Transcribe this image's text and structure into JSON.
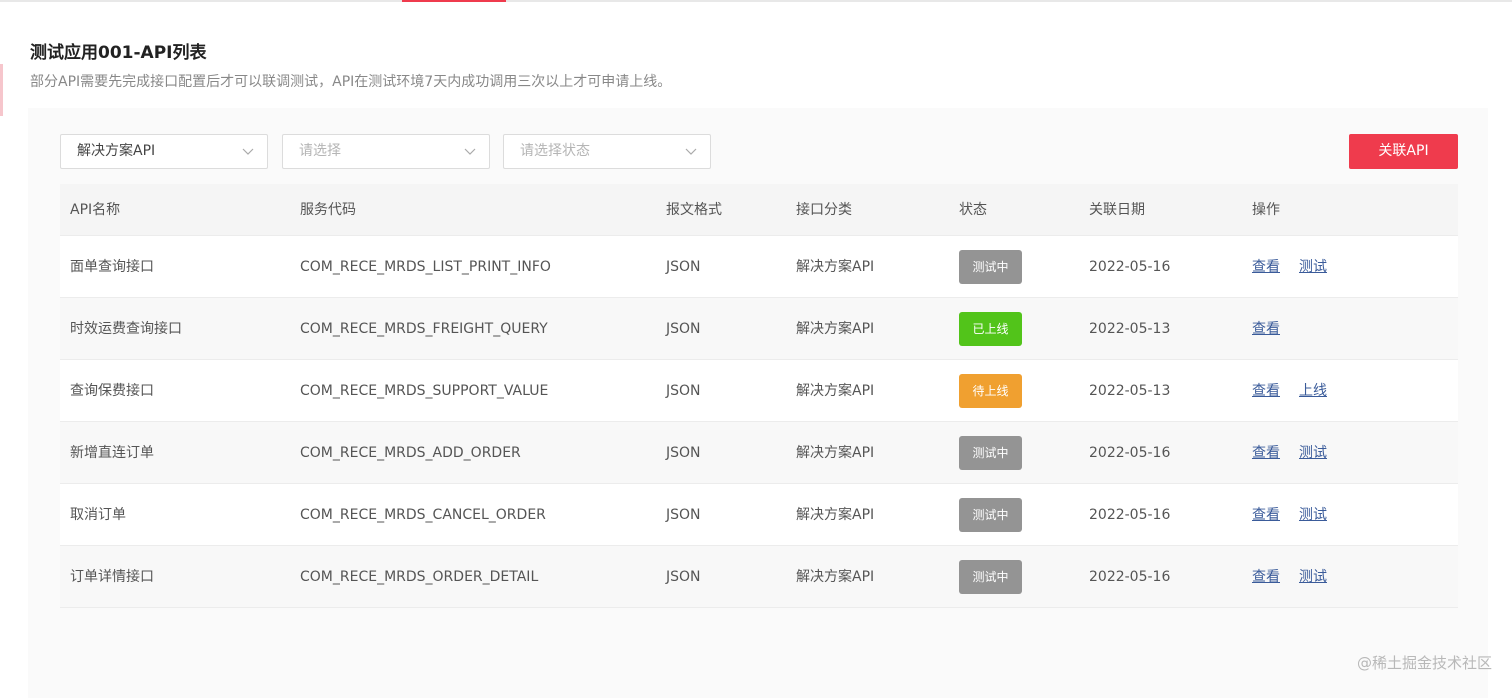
{
  "header": {
    "title": "测试应用001-API列表",
    "description": "部分API需要先完成接口配置后才可以联调测试，API在测试环境7天内成功调用三次以上才可申请上线。"
  },
  "filters": {
    "category": {
      "value": "解决方案API"
    },
    "select2": {
      "placeholder": "请选择"
    },
    "status": {
      "placeholder": "请选择状态"
    }
  },
  "toolbar": {
    "associate_label": "关联API"
  },
  "table": {
    "columns": [
      "API名称",
      "服务代码",
      "报文格式",
      "接口分类",
      "状态",
      "关联日期",
      "操作"
    ],
    "rows": [
      {
        "name": "面单查询接口",
        "code": "COM_RECE_MRDS_LIST_PRINT_INFO",
        "format": "JSON",
        "category": "解决方案API",
        "status": "测试中",
        "status_color": "#949494",
        "date": "2022-05-16",
        "actions": [
          "查看",
          "测试"
        ]
      },
      {
        "name": "时效运费查询接口",
        "code": "COM_RECE_MRDS_FREIGHT_QUERY",
        "format": "JSON",
        "category": "解决方案API",
        "status": "已上线",
        "status_color": "#52c41a",
        "date": "2022-05-13",
        "actions": [
          "查看"
        ]
      },
      {
        "name": "查询保费接口",
        "code": "COM_RECE_MRDS_SUPPORT_VALUE",
        "format": "JSON",
        "category": "解决方案API",
        "status": "待上线",
        "status_color": "#f0a030",
        "date": "2022-05-13",
        "actions": [
          "查看",
          "上线"
        ]
      },
      {
        "name": "新增直连订单",
        "code": "COM_RECE_MRDS_ADD_ORDER",
        "format": "JSON",
        "category": "解决方案API",
        "status": "测试中",
        "status_color": "#949494",
        "date": "2022-05-16",
        "actions": [
          "查看",
          "测试"
        ]
      },
      {
        "name": "取消订单",
        "code": "COM_RECE_MRDS_CANCEL_ORDER",
        "format": "JSON",
        "category": "解决方案API",
        "status": "测试中",
        "status_color": "#949494",
        "date": "2022-05-16",
        "actions": [
          "查看",
          "测试"
        ]
      },
      {
        "name": "订单详情接口",
        "code": "COM_RECE_MRDS_ORDER_DETAIL",
        "format": "JSON",
        "category": "解决方案API",
        "status": "测试中",
        "status_color": "#949494",
        "date": "2022-05-16",
        "actions": [
          "查看",
          "测试"
        ]
      }
    ]
  },
  "watermark": "@稀土掘金技术社区",
  "colors": {
    "accent": "#ef3b4d",
    "link": "#3a5b9a"
  }
}
